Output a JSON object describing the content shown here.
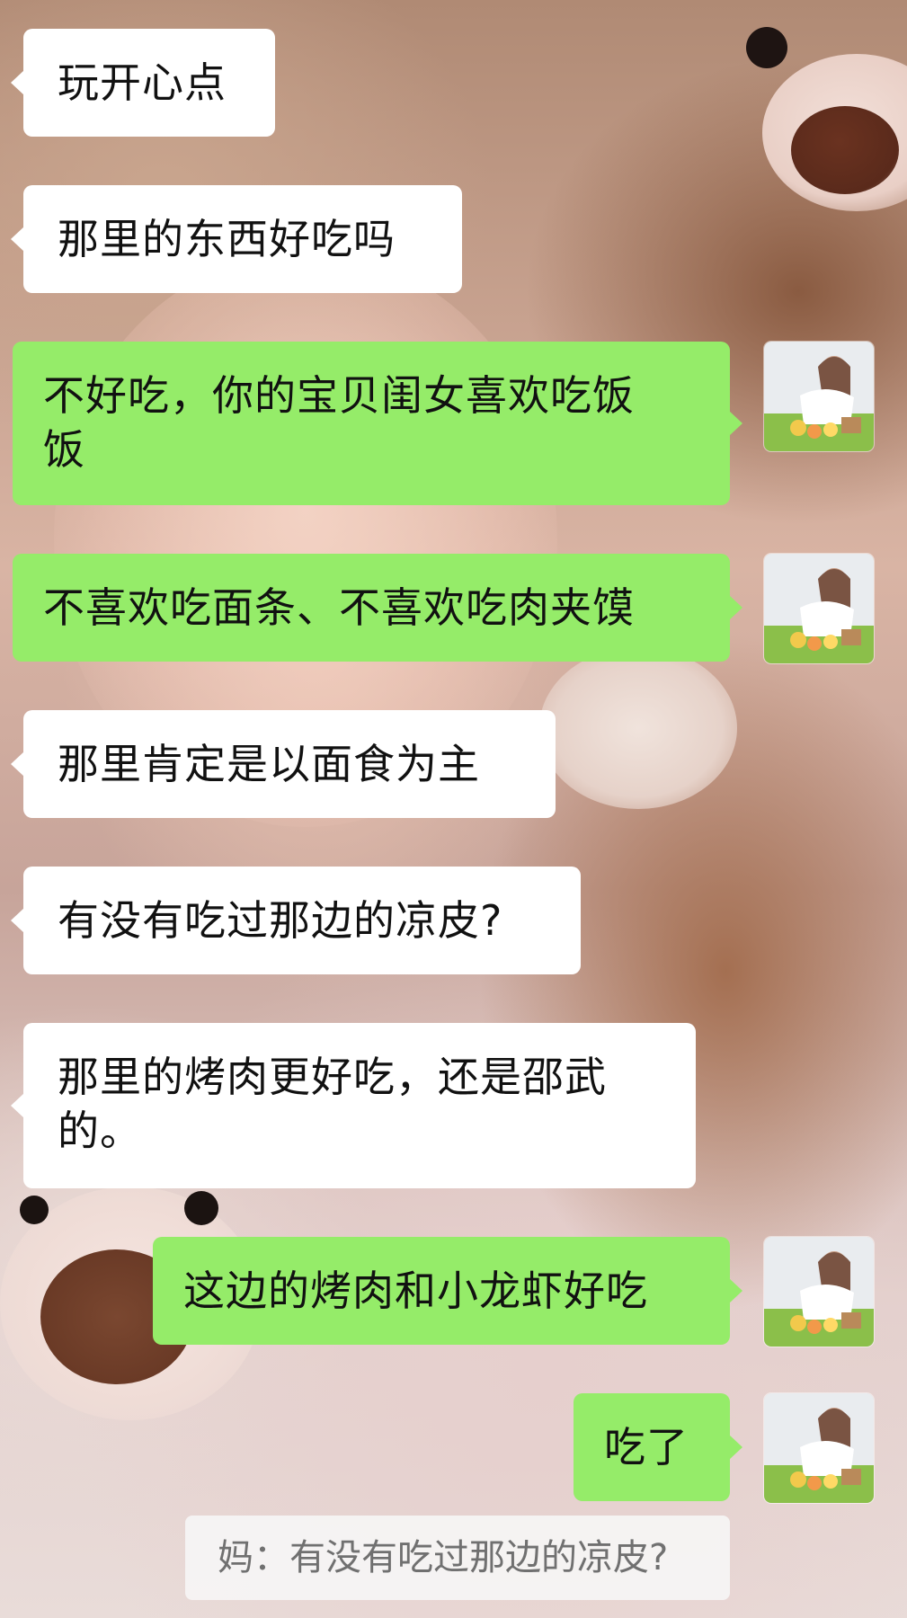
{
  "colors": {
    "incoming_bubble": "#ffffff",
    "outgoing_bubble": "#95ec69",
    "text": "#111111",
    "quote_text": "#707070"
  },
  "conversation": {
    "messages": [
      {
        "direction": "in",
        "text": "玩开心点"
      },
      {
        "direction": "in",
        "text": "那里的东西好吃吗"
      },
      {
        "direction": "out",
        "text": "不好吃，你的宝贝闺女喜欢吃饭\n饭"
      },
      {
        "direction": "out",
        "text": "不喜欢吃面条、不喜欢吃肉夹馍"
      },
      {
        "direction": "in",
        "text": "那里肯定是以面食为主"
      },
      {
        "direction": "in",
        "text": "有没有吃过那边的凉皮?"
      },
      {
        "direction": "in",
        "text": "那里的烤肉更好吃，还是邵武\n的。"
      },
      {
        "direction": "out",
        "text": "这边的烤肉和小龙虾好吃"
      },
      {
        "direction": "out",
        "text": "吃了"
      }
    ],
    "quoted_reply": "妈：有没有吃过那边的凉皮?"
  },
  "icons": {
    "self_avatar": "user-avatar-photo-icon"
  }
}
